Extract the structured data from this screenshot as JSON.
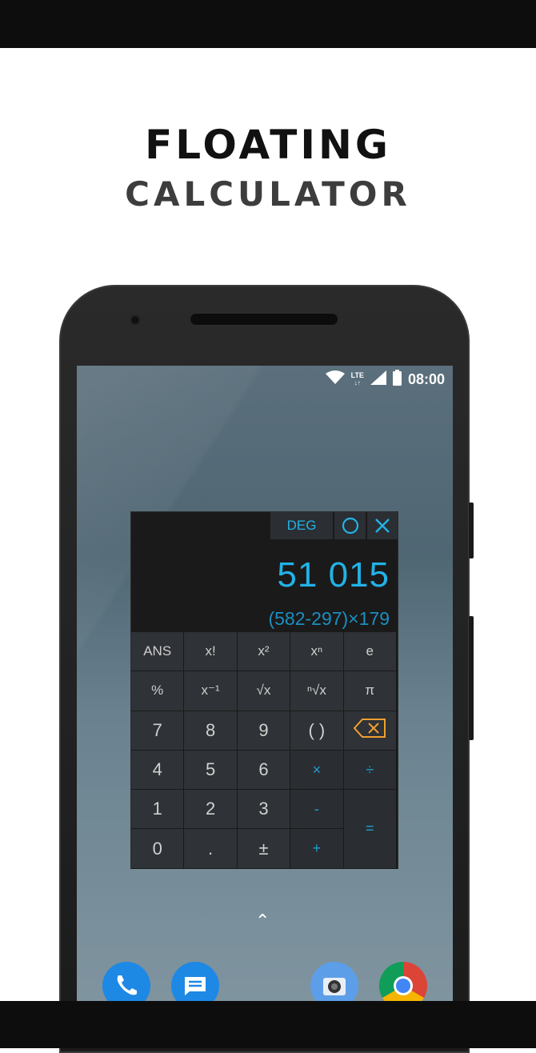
{
  "promo": {
    "title_line1": "FLOATING",
    "title_line2": "CALCULATOR"
  },
  "status_bar": {
    "network": "LTE",
    "time": "08:00"
  },
  "calculator": {
    "mode": "DEG",
    "result": "51 015",
    "expression": "(582-297)×179",
    "keys": [
      [
        "ANS",
        "x!",
        "x²",
        "xⁿ",
        "e"
      ],
      [
        "%",
        "x⁻¹",
        "√x",
        "ⁿ√x",
        "π"
      ],
      [
        "7",
        "8",
        "9",
        "( )",
        "backspace"
      ],
      [
        "4",
        "5",
        "6",
        "×",
        "÷"
      ],
      [
        "1",
        "2",
        "3",
        "-",
        "="
      ],
      [
        "0",
        ".",
        "±",
        "+"
      ]
    ],
    "accent_color": "#22b2e6",
    "backspace_color": "#f0a030"
  },
  "home": {
    "app_drawer_glyph": "⌃",
    "dock_apps": [
      "phone-icon",
      "messages-icon",
      "camera-icon",
      "chrome-icon"
    ]
  }
}
